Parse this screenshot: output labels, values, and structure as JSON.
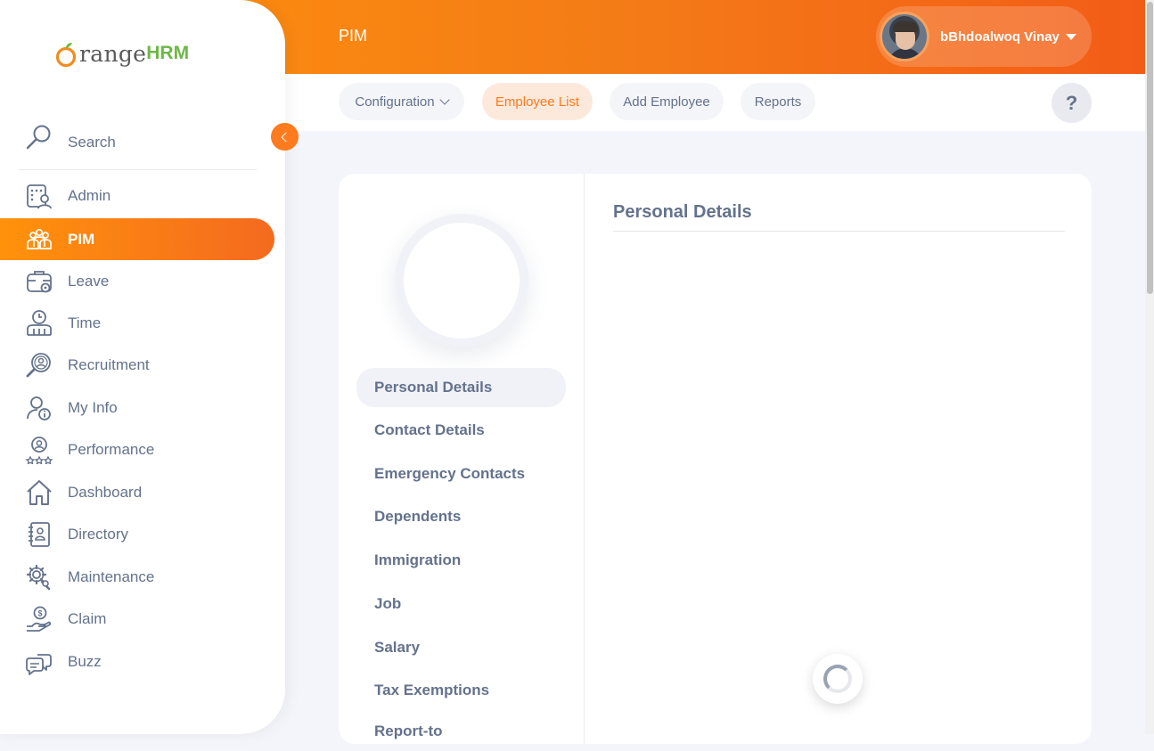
{
  "brand": {
    "logo_text": "range",
    "logo_hrm": "HRM",
    "logo_letter": "O"
  },
  "header": {
    "module_title": "PIM",
    "user_name": "bBhdoalwoq Vinay",
    "accent": "#ff7b1d"
  },
  "subnav": {
    "tabs": [
      {
        "label": "Configuration",
        "has_dropdown": true
      },
      {
        "label": "Employee List",
        "active": true
      },
      {
        "label": "Add Employee"
      },
      {
        "label": "Reports"
      }
    ],
    "help_label": "?"
  },
  "sidebar": {
    "search_label": "Search",
    "items": [
      {
        "label": "Admin",
        "icon": "admin-icon"
      },
      {
        "label": "PIM",
        "icon": "pim-icon",
        "active": true
      },
      {
        "label": "Leave",
        "icon": "leave-icon"
      },
      {
        "label": "Time",
        "icon": "time-icon"
      },
      {
        "label": "Recruitment",
        "icon": "recruitment-icon"
      },
      {
        "label": "My Info",
        "icon": "my-info-icon"
      },
      {
        "label": "Performance",
        "icon": "performance-icon"
      },
      {
        "label": "Dashboard",
        "icon": "dashboard-icon"
      },
      {
        "label": "Directory",
        "icon": "directory-icon"
      },
      {
        "label": "Maintenance",
        "icon": "maintenance-icon"
      },
      {
        "label": "Claim",
        "icon": "claim-icon"
      },
      {
        "label": "Buzz",
        "icon": "buzz-icon"
      }
    ]
  },
  "employee": {
    "tabs": [
      {
        "label": "Personal Details",
        "active": true
      },
      {
        "label": "Contact Details"
      },
      {
        "label": "Emergency Contacts"
      },
      {
        "label": "Dependents"
      },
      {
        "label": "Immigration"
      },
      {
        "label": "Job"
      },
      {
        "label": "Salary"
      },
      {
        "label": "Tax Exemptions"
      },
      {
        "label": "Report-to"
      }
    ],
    "section_title": "Personal Details",
    "loading": true
  }
}
